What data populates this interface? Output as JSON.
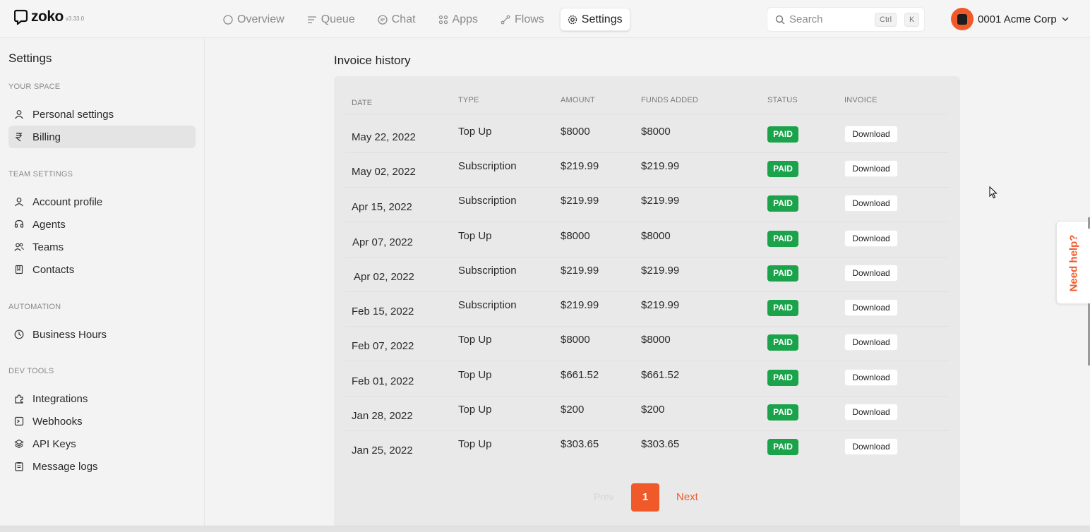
{
  "app": {
    "name": "zoko",
    "version": "v3.33.0"
  },
  "nav": [
    {
      "label": "Overview",
      "icon": "circle-icon"
    },
    {
      "label": "Queue",
      "icon": "queue-icon"
    },
    {
      "label": "Chat",
      "icon": "chat-icon"
    },
    {
      "label": "Apps",
      "icon": "apps-icon"
    },
    {
      "label": "Flows",
      "icon": "flows-icon"
    },
    {
      "label": "Settings",
      "icon": "gear-icon",
      "active": true
    }
  ],
  "search": {
    "placeholder": "Search",
    "shortcut_mod": "Ctrl",
    "shortcut_key": "K"
  },
  "account": {
    "name": "0001 Acme Corp"
  },
  "sidebar": {
    "title": "Settings",
    "sections": [
      {
        "label": "YOUR SPACE",
        "items": [
          {
            "label": "Personal settings"
          },
          {
            "label": "Billing",
            "active": true
          }
        ]
      },
      {
        "label": "TEAM SETTINGS",
        "items": [
          {
            "label": "Account profile"
          },
          {
            "label": "Agents"
          },
          {
            "label": "Teams"
          },
          {
            "label": "Contacts"
          }
        ]
      },
      {
        "label": "AUTOMATION",
        "items": [
          {
            "label": "Business Hours"
          }
        ]
      },
      {
        "label": "DEV TOOLS",
        "items": [
          {
            "label": "Integrations"
          },
          {
            "label": "Webhooks"
          },
          {
            "label": "API Keys"
          },
          {
            "label": "Message logs"
          }
        ]
      }
    ]
  },
  "invoices": {
    "title": "Invoice history",
    "columns": {
      "date": "DATE",
      "type": "TYPE",
      "amount": "AMOUNT",
      "funds": "FUNDS ADDED",
      "status": "STATUS",
      "invoice": "INVOICE"
    },
    "rows": [
      {
        "date": "May 22, 2022",
        "type": "Top Up",
        "amount": "$8000",
        "funds": "$8000",
        "status": "PAID",
        "action": "Download"
      },
      {
        "date": "May 02, 2022",
        "type": "Subscription",
        "amount": "$219.99",
        "funds": "$219.99",
        "status": "PAID",
        "action": "Download"
      },
      {
        "date": "Apr 15, 2022",
        "type": "Subscription",
        "amount": "$219.99",
        "funds": "$219.99",
        "status": "PAID",
        "action": "Download"
      },
      {
        "date": "Apr 07, 2022",
        "type": "Top Up",
        "amount": "$8000",
        "funds": "$8000",
        "status": "PAID",
        "action": "Download"
      },
      {
        "date": "Apr 02, 2022",
        "type": "Subscription",
        "amount": "$219.99",
        "funds": "$219.99",
        "status": "PAID",
        "action": "Download"
      },
      {
        "date": "Feb 15, 2022",
        "type": "Subscription",
        "amount": "$219.99",
        "funds": "$219.99",
        "status": "PAID",
        "action": "Download"
      },
      {
        "date": "Feb 07, 2022",
        "type": "Top Up",
        "amount": "$8000",
        "funds": "$8000",
        "status": "PAID",
        "action": "Download"
      },
      {
        "date": "Feb 01, 2022",
        "type": "Top Up",
        "amount": "$661.52",
        "funds": "$661.52",
        "status": "PAID",
        "action": "Download"
      },
      {
        "date": "Jan 28, 2022",
        "type": "Top Up",
        "amount": "$200",
        "funds": "$200",
        "status": "PAID",
        "action": "Download"
      },
      {
        "date": "Jan 25, 2022",
        "type": "Top Up",
        "amount": "$303.65",
        "funds": "$303.65",
        "status": "PAID",
        "action": "Download"
      }
    ],
    "pagination": {
      "prev": "Prev",
      "current": "1",
      "next": "Next"
    }
  },
  "help": {
    "label": "Need help?"
  },
  "colors": {
    "accent": "#f05a2b",
    "paid": "#1aa34a"
  }
}
